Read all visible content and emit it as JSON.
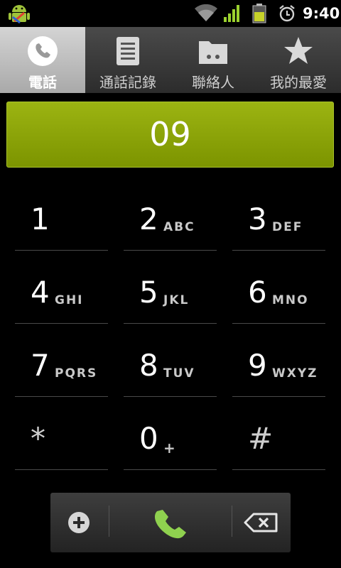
{
  "status_bar": {
    "time": "9:40",
    "icons": [
      "android-notification-icon",
      "wifi-icon",
      "signal-icon",
      "battery-icon",
      "alarm-icon"
    ]
  },
  "tabs": [
    {
      "label": "電話",
      "icon": "phone-icon",
      "active": true
    },
    {
      "label": "通話記錄",
      "icon": "call-log-icon",
      "active": false
    },
    {
      "label": "聯絡人",
      "icon": "contacts-icon",
      "active": false
    },
    {
      "label": "我的最愛",
      "icon": "star-icon",
      "active": false
    }
  ],
  "display": {
    "number": "09"
  },
  "keypad": [
    {
      "digit": "1",
      "letters": ""
    },
    {
      "digit": "2",
      "letters": "ABC"
    },
    {
      "digit": "3",
      "letters": "DEF"
    },
    {
      "digit": "4",
      "letters": "GHI"
    },
    {
      "digit": "5",
      "letters": "JKL"
    },
    {
      "digit": "6",
      "letters": "MNO"
    },
    {
      "digit": "7",
      "letters": "PQRS"
    },
    {
      "digit": "8",
      "letters": "TUV"
    },
    {
      "digit": "9",
      "letters": "WXYZ"
    },
    {
      "digit": "*",
      "letters": ""
    },
    {
      "digit": "0",
      "letters": "+"
    },
    {
      "digit": "#",
      "letters": ""
    }
  ],
  "actions": {
    "add_contact_icon": "add-contact-icon",
    "call_icon": "call-icon",
    "backspace_icon": "backspace-icon"
  },
  "colors": {
    "display_green": "#8aa60a",
    "call_green": "#8fd14f",
    "active_tab": "#bfbfbf"
  }
}
